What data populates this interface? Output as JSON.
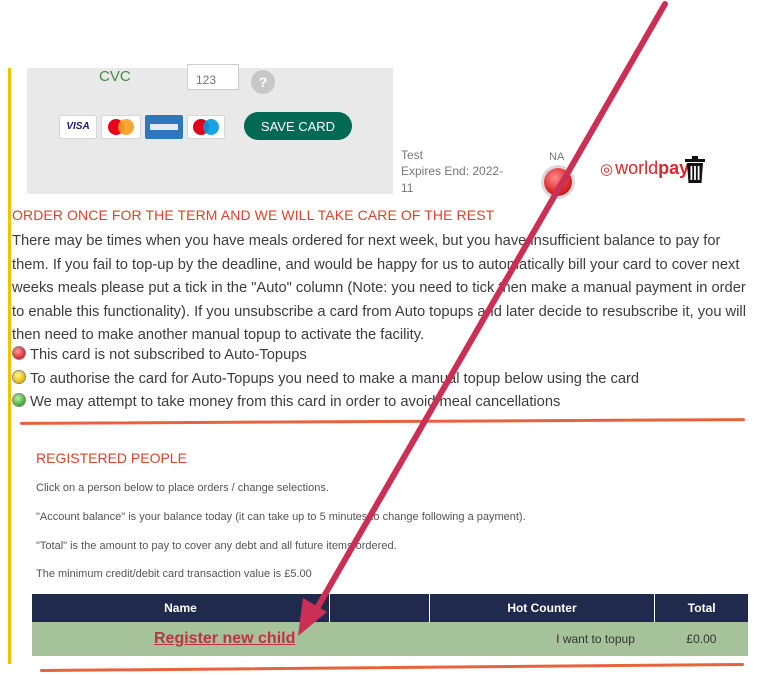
{
  "card_form": {
    "cvc_label": "CVC",
    "cvc_placeholder": "123",
    "help_icon_text": "?",
    "visa_text": "VISA",
    "save_card_label": "SAVE CARD"
  },
  "saved_card": {
    "name": "Test",
    "expiry": "Expires End: 2022-11",
    "status_text": "NA",
    "status_color": "#d9262b",
    "provider_prefix": "world",
    "provider_suffix": "pay"
  },
  "auto_topup": {
    "heading": "ORDER ONCE FOR THE TERM AND WE WILL TAKE CARE OF THE REST",
    "description": "There may be times when you have meals ordered for next week, but you have insufficient balance to pay for them. If you fail to top-up by the deadline, and would be happy for us to automatically bill your card to cover next weeks meals please put a tick in the \"Auto\" column (Note: you need to tick then make a manual payment in order to enable this functionality). If you unsubscribe a card from Auto topups and later decide to resubscribe it, you will then need to make another manual topup to activate the facility.",
    "legend": [
      {
        "color": "red",
        "text": "This card is not subscribed to Auto-Topups"
      },
      {
        "color": "yellow",
        "text": "To authorise the card for Auto-Topups you need to make a manual topup below using the card"
      },
      {
        "color": "green",
        "text": "We may attempt to take money from this card in order to avoid meal cancellations"
      }
    ]
  },
  "registered_people": {
    "heading": "REGISTERED PEOPLE",
    "lines": [
      "Click on a person below to place orders / change selections.",
      "\"Account balance\" is your balance today (it can take up to 5 minutes to change following a payment).",
      "\"Total\" is the amount to pay to cover any debt and all future items ordered.",
      "The minimum credit/debit card transaction value is £5.00"
    ],
    "table": {
      "headers": [
        "Name",
        "",
        "Hot Counter",
        "Total"
      ],
      "row": {
        "name_link": "Register new child",
        "hot_counter": "I want to topup",
        "total": "£0.00"
      }
    }
  },
  "colors": {
    "accent_red": "#d6452b",
    "brand_green": "#006a55",
    "table_header": "#1f2a4d",
    "table_row": "#a5c29a",
    "annotation_arrow": "#cc2f55",
    "annotation_underline": "#e8623e"
  }
}
